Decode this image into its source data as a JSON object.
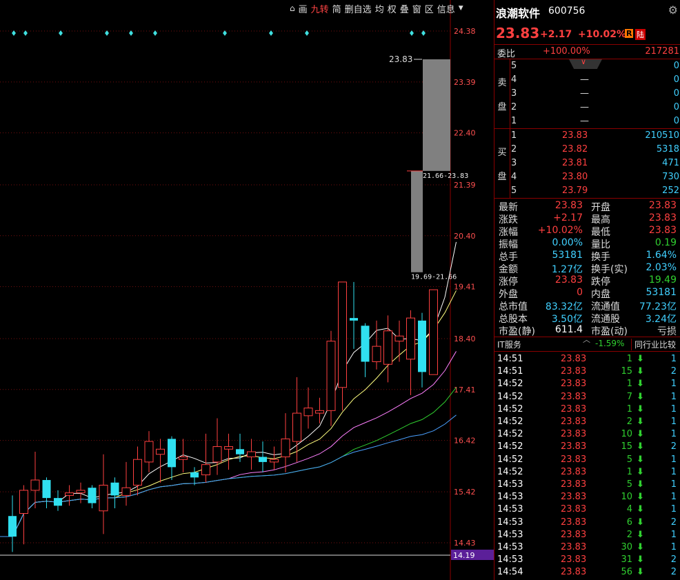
{
  "toolbar": {
    "items": [
      "画",
      "九转",
      "简",
      "删自选",
      "均",
      "权",
      "叠",
      "窗",
      "区",
      "信息"
    ]
  },
  "chart_data": {
    "type": "candlestick",
    "price_axis": [
      "24.38",
      "23.39",
      "22.40",
      "21.39",
      "20.40",
      "19.41",
      "18.40",
      "17.41",
      "16.42",
      "15.42",
      "14.43"
    ],
    "last_close_marker": "14.19",
    "annotation_top": "23.83",
    "range_upper": "21.66-23.83",
    "range_lower": "19.69-21.66",
    "candles": [
      {
        "o": 14.95,
        "c": 14.55,
        "h": 15.35,
        "l": 14.25
      },
      {
        "o": 15.0,
        "c": 15.45,
        "h": 15.55,
        "l": 14.4
      },
      {
        "o": 15.45,
        "c": 15.65,
        "h": 16.2,
        "l": 15.1
      },
      {
        "o": 15.65,
        "c": 15.3,
        "h": 15.7,
        "l": 15.1
      },
      {
        "o": 15.3,
        "c": 15.15,
        "h": 15.45,
        "l": 15.05
      },
      {
        "o": 15.35,
        "c": 15.4,
        "h": 15.55,
        "l": 15.15
      },
      {
        "o": 15.4,
        "c": 15.45,
        "h": 15.6,
        "l": 15.2
      },
      {
        "o": 15.5,
        "c": 15.2,
        "h": 15.55,
        "l": 15.1
      },
      {
        "o": 15.05,
        "c": 15.55,
        "h": 16.15,
        "l": 14.6
      },
      {
        "o": 15.6,
        "c": 15.35,
        "h": 15.7,
        "l": 15.1
      },
      {
        "o": 15.35,
        "c": 15.5,
        "h": 16.0,
        "l": 15.15
      },
      {
        "o": 15.55,
        "c": 16.05,
        "h": 16.3,
        "l": 15.35
      },
      {
        "o": 16.0,
        "c": 16.4,
        "h": 16.6,
        "l": 15.8
      },
      {
        "o": 16.15,
        "c": 16.25,
        "h": 16.45,
        "l": 15.6
      },
      {
        "o": 16.45,
        "c": 15.9,
        "h": 16.5,
        "l": 15.65
      },
      {
        "o": 16.05,
        "c": 16.1,
        "h": 16.45,
        "l": 15.8
      },
      {
        "o": 15.8,
        "c": 15.7,
        "h": 15.9,
        "l": 15.55
      },
      {
        "o": 15.75,
        "c": 15.95,
        "h": 16.55,
        "l": 15.6
      },
      {
        "o": 16.0,
        "c": 16.3,
        "h": 16.85,
        "l": 15.75
      },
      {
        "o": 16.25,
        "c": 16.3,
        "h": 16.55,
        "l": 15.85
      },
      {
        "o": 16.25,
        "c": 16.15,
        "h": 16.55,
        "l": 16.0
      },
      {
        "o": 16.1,
        "c": 16.2,
        "h": 16.45,
        "l": 15.85
      },
      {
        "o": 16.1,
        "c": 16.0,
        "h": 16.4,
        "l": 15.8
      },
      {
        "o": 16.0,
        "c": 16.05,
        "h": 16.3,
        "l": 15.85
      },
      {
        "o": 16.1,
        "c": 16.45,
        "h": 16.95,
        "l": 15.8
      },
      {
        "o": 16.4,
        "c": 16.95,
        "h": 17.65,
        "l": 16.0
      },
      {
        "o": 16.9,
        "c": 17.05,
        "h": 17.45,
        "l": 16.65
      },
      {
        "o": 16.95,
        "c": 17.0,
        "h": 17.25,
        "l": 16.75
      },
      {
        "o": 17.0,
        "c": 18.35,
        "h": 18.55,
        "l": 16.7
      },
      {
        "o": 17.45,
        "c": 19.5,
        "h": 19.5,
        "l": 17.0
      },
      {
        "o": 18.8,
        "c": 18.75,
        "h": 19.5,
        "l": 18.2
      },
      {
        "o": 18.65,
        "c": 17.95,
        "h": 18.7,
        "l": 17.65
      },
      {
        "o": 17.95,
        "c": 18.25,
        "h": 18.75,
        "l": 17.8
      },
      {
        "o": 17.9,
        "c": 18.55,
        "h": 18.85,
        "l": 17.55
      },
      {
        "o": 18.35,
        "c": 18.45,
        "h": 18.75,
        "l": 17.95
      },
      {
        "o": 18.0,
        "c": 18.8,
        "h": 18.95,
        "l": 17.3
      },
      {
        "o": 18.75,
        "c": 17.75,
        "h": 18.9,
        "l": 17.45
      },
      {
        "o": 17.7,
        "c": 19.35,
        "h": 19.35,
        "l": 17.7
      },
      {
        "o": 19.69,
        "c": 21.66,
        "h": 21.66,
        "l": 19.69
      },
      {
        "o": 21.66,
        "c": 23.83,
        "h": 23.83,
        "l": 21.66
      }
    ]
  },
  "right": {
    "name": "浪潮软件",
    "code": "600756",
    "price": "23.83",
    "change": "+2.17",
    "pct": "+10.02%",
    "badge_r": "R",
    "badge_lu": "陆",
    "wb_label": "委比",
    "wb_pct": "+100.00%",
    "wb_diff": "217281",
    "sell_label": [
      "卖",
      "盘"
    ],
    "buy_label": [
      "买",
      "盘"
    ],
    "sell": [
      {
        "lv": "5",
        "p": "",
        "v": "0"
      },
      {
        "lv": "4",
        "p": "—",
        "v": "0"
      },
      {
        "lv": "3",
        "p": "—",
        "v": "0"
      },
      {
        "lv": "2",
        "p": "—",
        "v": "0"
      },
      {
        "lv": "1",
        "p": "—",
        "v": "0"
      }
    ],
    "buy": [
      {
        "lv": "1",
        "p": "23.83",
        "v": "210510"
      },
      {
        "lv": "2",
        "p": "23.82",
        "v": "5318"
      },
      {
        "lv": "3",
        "p": "23.81",
        "v": "471"
      },
      {
        "lv": "4",
        "p": "23.80",
        "v": "730"
      },
      {
        "lv": "5",
        "p": "23.79",
        "v": "252"
      }
    ],
    "stats": [
      {
        "k1": "最新",
        "v1": "23.83",
        "c1": "red",
        "k2": "开盘",
        "v2": "23.83",
        "c2": "red"
      },
      {
        "k1": "涨跌",
        "v1": "+2.17",
        "c1": "red",
        "k2": "最高",
        "v2": "23.83",
        "c2": "red"
      },
      {
        "k1": "涨幅",
        "v1": "+10.02%",
        "c1": "red",
        "k2": "最低",
        "v2": "23.83",
        "c2": "red"
      },
      {
        "k1": "振幅",
        "v1": "0.00%",
        "c1": "cyan",
        "k2": "量比",
        "v2": "0.19",
        "c2": "green"
      },
      {
        "k1": "总手",
        "v1": "53181",
        "c1": "cyan",
        "k2": "换手",
        "v2": "1.64%",
        "c2": "cyan"
      },
      {
        "k1": "金额",
        "v1": "1.27亿",
        "c1": "cyan",
        "k2": "换手(实)",
        "v2": "2.03%",
        "c2": "cyan"
      },
      {
        "k1": "涨停",
        "v1": "23.83",
        "c1": "red",
        "k2": "跌停",
        "v2": "19.49",
        "c2": "green"
      },
      {
        "k1": "外盘",
        "v1": "0",
        "c1": "red",
        "k2": "内盘",
        "v2": "53181",
        "c2": "cyan"
      },
      {
        "k1": "总市值",
        "v1": "83.32亿",
        "c1": "cyan",
        "k2": "流通值",
        "v2": "77.23亿",
        "c2": "cyan"
      },
      {
        "k1": "总股本",
        "v1": "3.50亿",
        "c1": "cyan",
        "k2": "流通股",
        "v2": "3.24亿",
        "c2": "cyan"
      },
      {
        "k1": "市盈(静)",
        "v1": "611.4",
        "c1": "white",
        "k2": "市盈(动)",
        "v2": "亏损",
        "c2": "grey"
      }
    ],
    "industry_name": "IT服务",
    "industry_pct": "-1.59%",
    "industry_btn": "同行业比较",
    "ticks": [
      {
        "t": "14:51",
        "p": "23.83",
        "v": "1",
        "n": "1"
      },
      {
        "t": "14:51",
        "p": "23.83",
        "v": "15",
        "n": "2"
      },
      {
        "t": "14:52",
        "p": "23.83",
        "v": "1",
        "n": "1"
      },
      {
        "t": "14:52",
        "p": "23.83",
        "v": "7",
        "n": "1"
      },
      {
        "t": "14:52",
        "p": "23.83",
        "v": "1",
        "n": "1"
      },
      {
        "t": "14:52",
        "p": "23.83",
        "v": "2",
        "n": "1"
      },
      {
        "t": "14:52",
        "p": "23.83",
        "v": "10",
        "n": "1"
      },
      {
        "t": "14:52",
        "p": "23.83",
        "v": "15",
        "n": "2"
      },
      {
        "t": "14:52",
        "p": "23.83",
        "v": "5",
        "n": "1"
      },
      {
        "t": "14:52",
        "p": "23.83",
        "v": "1",
        "n": "1"
      },
      {
        "t": "14:53",
        "p": "23.83",
        "v": "5",
        "n": "1"
      },
      {
        "t": "14:53",
        "p": "23.83",
        "v": "10",
        "n": "1"
      },
      {
        "t": "14:53",
        "p": "23.83",
        "v": "4",
        "n": "1"
      },
      {
        "t": "14:53",
        "p": "23.83",
        "v": "6",
        "n": "2"
      },
      {
        "t": "14:53",
        "p": "23.83",
        "v": "2",
        "n": "1"
      },
      {
        "t": "14:53",
        "p": "23.83",
        "v": "30",
        "n": "1"
      },
      {
        "t": "14:53",
        "p": "23.83",
        "v": "31",
        "n": "2"
      },
      {
        "t": "14:54",
        "p": "23.83",
        "v": "56",
        "n": "2"
      }
    ]
  }
}
